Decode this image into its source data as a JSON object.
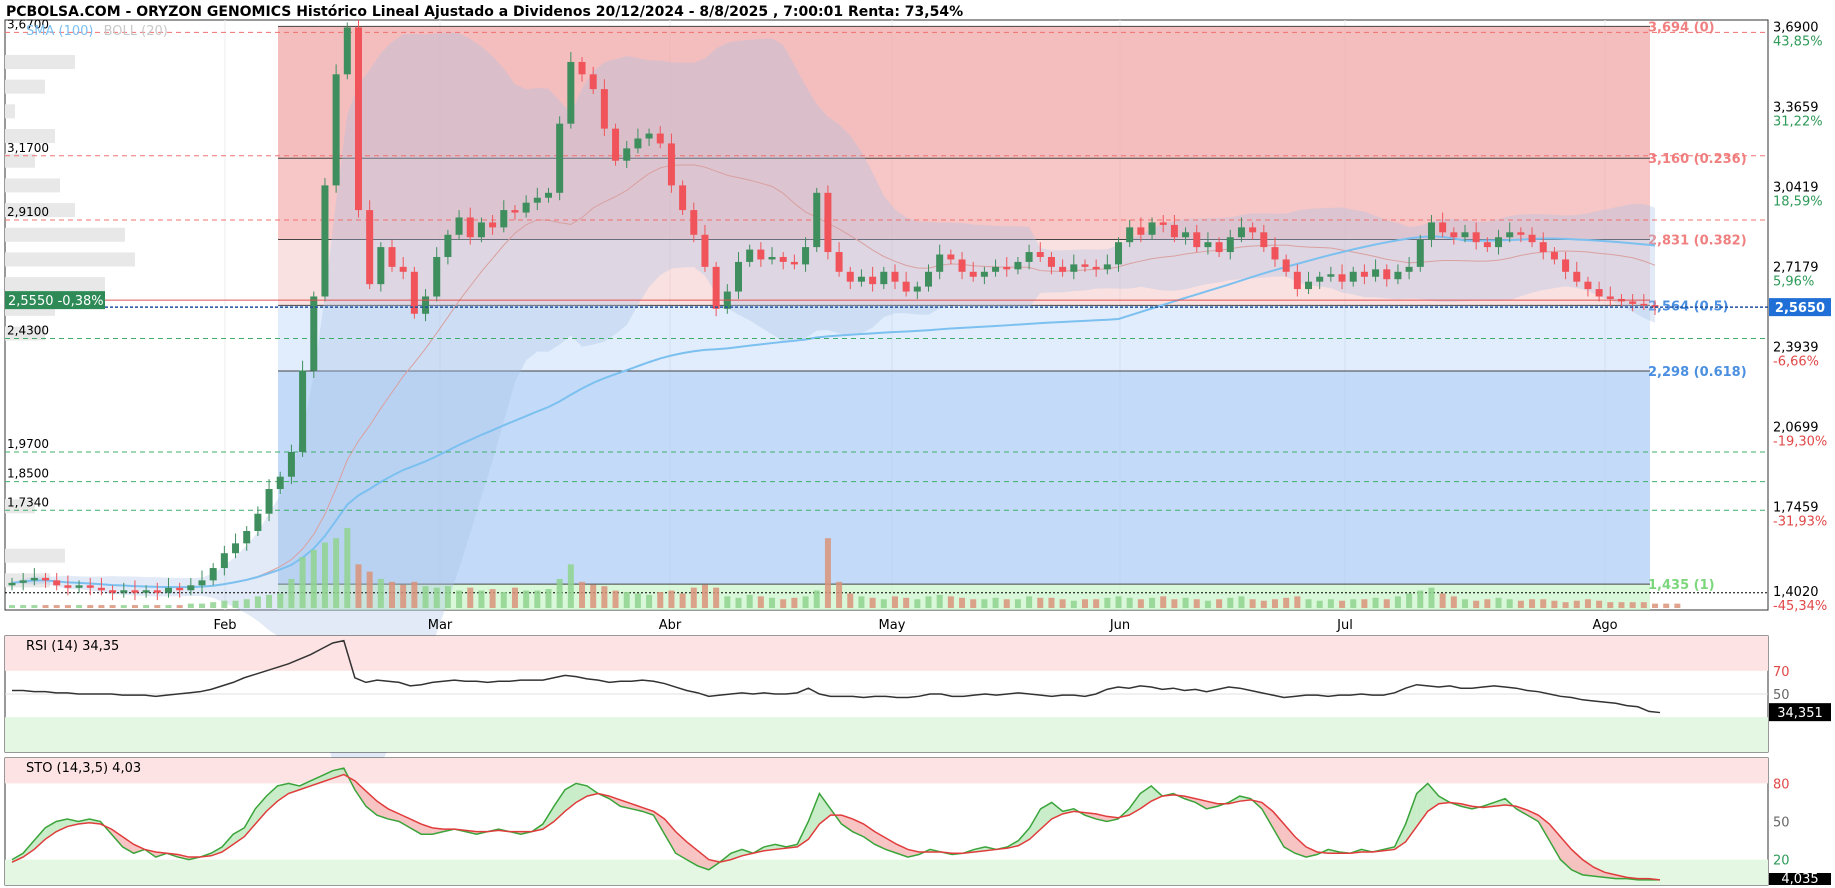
{
  "header": {
    "title": "PCBOLSA.COM - ORYZON GENOMICS Histórico Lineal Ajustado a Dividenos 20/12/2024 - 8/8/2025 , 7:00:01 Renta: 73,54%",
    "sma_label": "SMA (100)",
    "boll_label": "BOLL (20)"
  },
  "colors": {
    "up": "#3e8e5e",
    "down": "#f0545a",
    "sma": "#7cc0f0",
    "fib_red": "#f2a8a8",
    "fib_blue": "#a9ccf6",
    "fib_green": "#c9f3c9",
    "price_tag": "#2e8b57",
    "last_tag": "#1f6fd6"
  },
  "chart_data": [
    {
      "type": "candlestick",
      "title": "",
      "x_labels": [
        "Feb",
        "Mar",
        "Abr",
        "May",
        "Jun",
        "Jul",
        "Ago"
      ],
      "current_price": {
        "value": 2.565,
        "label": "2,5650",
        "tag": "2,5550  -0,38%"
      },
      "right_axis": [
        {
          "price": "3,6900",
          "pct": "43,85%"
        },
        {
          "price": "3,3659",
          "pct": "31,22%"
        },
        {
          "price": "3,0419",
          "pct": "18,59%"
        },
        {
          "price": "2,7179",
          "pct": "5,96%"
        },
        {
          "price": "2,3939",
          "pct": "-6,66%"
        },
        {
          "price": "2,0699",
          "pct": "-19,30%"
        },
        {
          "price": "1,7459",
          "pct": "-31,93%"
        },
        {
          "price": "1,4020",
          "pct": "-45,34%"
        }
      ],
      "left_levels": [
        "3,6700",
        "3,1700",
        "2,9100",
        "2,4300",
        "1,9700",
        "1,8500",
        "1,7340"
      ],
      "fibonacci": [
        "3,694 (0)",
        "3,160 (0.236)",
        "2,831 (0.382)",
        "2,564 (0.5)",
        "2,298 (0.618)",
        "1,435 (1)"
      ],
      "closes": [
        1.44,
        1.45,
        1.46,
        1.45,
        1.43,
        1.42,
        1.43,
        1.42,
        1.41,
        1.4,
        1.41,
        1.4,
        1.41,
        1.4,
        1.42,
        1.41,
        1.43,
        1.45,
        1.5,
        1.56,
        1.6,
        1.65,
        1.72,
        1.82,
        1.87,
        1.97,
        2.3,
        2.6,
        3.05,
        3.5,
        3.69,
        2.95,
        2.65,
        2.8,
        2.72,
        2.7,
        2.53,
        2.6,
        2.76,
        2.85,
        2.92,
        2.84,
        2.9,
        2.88,
        2.95,
        2.94,
        2.98,
        3.0,
        3.02,
        3.3,
        3.55,
        3.5,
        3.44,
        3.28,
        3.15,
        3.2,
        3.24,
        3.26,
        3.22,
        3.05,
        2.95,
        2.85,
        2.72,
        2.55,
        2.62,
        2.74,
        2.79,
        2.75,
        2.76,
        2.74,
        2.73,
        2.8,
        3.02,
        2.78,
        2.7,
        2.66,
        2.68,
        2.65,
        2.7,
        2.66,
        2.62,
        2.64,
        2.7,
        2.77,
        2.75,
        2.7,
        2.68,
        2.7,
        2.72,
        2.71,
        2.74,
        2.78,
        2.76,
        2.72,
        2.7,
        2.73,
        2.72,
        2.71,
        2.73,
        2.82,
        2.88,
        2.85,
        2.9,
        2.89,
        2.84,
        2.86,
        2.8,
        2.82,
        2.78,
        2.84,
        2.88,
        2.86,
        2.8,
        2.75,
        2.7,
        2.63,
        2.66,
        2.68,
        2.69,
        2.66,
        2.7,
        2.68,
        2.71,
        2.67,
        2.7,
        2.72,
        2.83,
        2.9,
        2.86,
        2.84,
        2.86,
        2.82,
        2.8,
        2.84,
        2.86,
        2.85,
        2.82,
        2.78,
        2.75,
        2.7,
        2.66,
        2.63,
        2.6,
        2.59,
        2.58,
        2.57,
        2.565,
        2.555
      ],
      "volume": [
        2,
        2,
        2,
        2,
        2,
        2,
        2,
        2,
        2,
        2,
        2,
        2,
        2,
        2,
        2,
        2,
        3,
        3,
        4,
        5,
        5,
        6,
        8,
        9,
        10,
        20,
        35,
        40,
        45,
        48,
        55,
        30,
        25,
        20,
        18,
        16,
        18,
        15,
        14,
        15,
        12,
        14,
        12,
        13,
        11,
        14,
        12,
        12,
        13,
        20,
        30,
        18,
        16,
        15,
        12,
        11,
        10,
        9,
        11,
        12,
        10,
        14,
        16,
        14,
        8,
        7,
        9,
        8,
        7,
        6,
        7,
        8,
        12,
        48,
        18,
        10,
        8,
        7,
        6,
        8,
        7,
        6,
        8,
        9,
        8,
        7,
        6,
        6,
        7,
        6,
        6,
        8,
        7,
        7,
        6,
        5,
        6,
        6,
        7,
        8,
        7,
        6,
        7,
        8,
        6,
        7,
        6,
        5,
        6,
        7,
        8,
        6,
        5,
        6,
        7,
        8,
        6,
        5,
        6,
        5,
        6,
        6,
        7,
        6,
        8,
        10,
        12,
        14,
        10,
        8,
        6,
        5,
        6,
        7,
        6,
        5,
        6,
        6,
        5,
        4,
        5,
        6,
        5,
        4,
        4,
        4,
        4,
        3,
        3,
        3
      ]
    },
    {
      "type": "line",
      "title": "RSI (14)",
      "value_label": "34,35",
      "last_tag": "34,351",
      "levels": [
        "70",
        "50"
      ],
      "ylim": [
        0,
        100
      ],
      "values": [
        53,
        53,
        52,
        52,
        51,
        51,
        50,
        50,
        50,
        50,
        49,
        49,
        49,
        48,
        49,
        50,
        51,
        52,
        54,
        57,
        60,
        64,
        67,
        70,
        73,
        76,
        80,
        84,
        89,
        94,
        96,
        64,
        60,
        62,
        61,
        60,
        57,
        58,
        60,
        61,
        62,
        61,
        61,
        60,
        61,
        61,
        62,
        62,
        62,
        64,
        66,
        65,
        63,
        62,
        60,
        61,
        61,
        62,
        61,
        59,
        56,
        53,
        51,
        48,
        49,
        50,
        51,
        50,
        51,
        50,
        50,
        51,
        55,
        50,
        48,
        48,
        48,
        47,
        48,
        48,
        47,
        47,
        48,
        50,
        50,
        48,
        48,
        49,
        50,
        49,
        50,
        51,
        50,
        49,
        48,
        49,
        49,
        48,
        50,
        54,
        56,
        55,
        57,
        56,
        54,
        55,
        53,
        54,
        52,
        54,
        56,
        55,
        53,
        51,
        49,
        47,
        48,
        49,
        49,
        48,
        49,
        49,
        50,
        49,
        49,
        51,
        55,
        58,
        57,
        56,
        57,
        55,
        55,
        56,
        57,
        56,
        55,
        53,
        52,
        50,
        48,
        47,
        45,
        44,
        43,
        42,
        40,
        39,
        35,
        34
      ]
    },
    {
      "type": "line",
      "title": "STO (14,3,5)",
      "value_label": "4,03",
      "last_tag": "4,035",
      "levels": [
        "80",
        "50",
        "20"
      ],
      "ylim": [
        0,
        100
      ],
      "k": [
        20,
        25,
        35,
        45,
        50,
        52,
        50,
        52,
        50,
        40,
        30,
        25,
        28,
        22,
        25,
        22,
        20,
        22,
        25,
        30,
        40,
        45,
        60,
        70,
        78,
        80,
        78,
        82,
        86,
        90,
        92,
        75,
        62,
        55,
        52,
        50,
        45,
        40,
        40,
        42,
        44,
        42,
        40,
        42,
        44,
        42,
        40,
        42,
        48,
        62,
        75,
        80,
        78,
        72,
        68,
        62,
        60,
        58,
        55,
        40,
        25,
        20,
        15,
        12,
        18,
        25,
        28,
        25,
        30,
        32,
        30,
        32,
        50,
        72,
        60,
        48,
        42,
        38,
        32,
        28,
        25,
        22,
        24,
        28,
        26,
        24,
        25,
        28,
        30,
        28,
        30,
        35,
        45,
        60,
        65,
        58,
        60,
        55,
        52,
        50,
        52,
        60,
        72,
        78,
        70,
        72,
        68,
        65,
        60,
        62,
        65,
        70,
        68,
        60,
        45,
        30,
        25,
        22,
        24,
        28,
        26,
        25,
        28,
        26,
        28,
        30,
        48,
        72,
        80,
        70,
        65,
        62,
        60,
        62,
        65,
        68,
        60,
        55,
        50,
        35,
        20,
        12,
        8,
        7,
        6,
        5,
        5,
        4,
        4,
        4
      ],
      "d": [
        18,
        22,
        28,
        36,
        42,
        46,
        48,
        49,
        48,
        44,
        38,
        32,
        28,
        26,
        25,
        24,
        22,
        22,
        23,
        26,
        32,
        38,
        48,
        58,
        66,
        72,
        75,
        78,
        81,
        84,
        87,
        82,
        74,
        66,
        60,
        56,
        52,
        48,
        45,
        44,
        44,
        43,
        42,
        42,
        43,
        42,
        42,
        42,
        44,
        50,
        58,
        65,
        70,
        72,
        70,
        67,
        64,
        61,
        58,
        52,
        42,
        34,
        27,
        20,
        18,
        20,
        23,
        25,
        27,
        28,
        29,
        30,
        36,
        48,
        55,
        55,
        52,
        48,
        42,
        37,
        32,
        28,
        26,
        26,
        26,
        25,
        25,
        26,
        27,
        28,
        29,
        31,
        36,
        44,
        52,
        56,
        58,
        57,
        56,
        54,
        53,
        55,
        60,
        66,
        70,
        71,
        70,
        68,
        66,
        64,
        64,
        66,
        67,
        65,
        58,
        48,
        38,
        30,
        26,
        25,
        25,
        25,
        26,
        26,
        27,
        28,
        34,
        46,
        58,
        64,
        65,
        64,
        62,
        61,
        62,
        63,
        62,
        59,
        55,
        48,
        38,
        28,
        20,
        14,
        10,
        8,
        6,
        5,
        5,
        4
      ]
    }
  ]
}
